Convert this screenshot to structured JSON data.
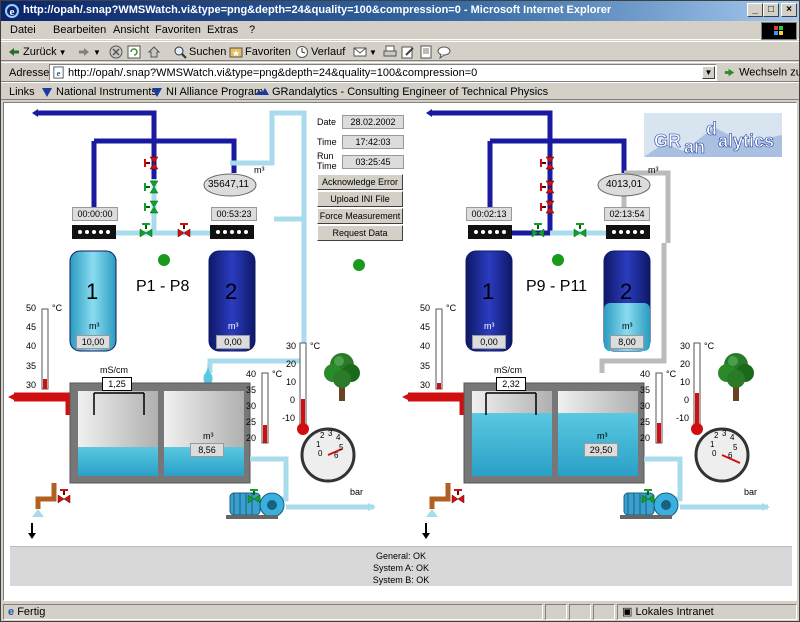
{
  "window": {
    "title": "http://opah/.snap?WMSWatch.vi&type=png&depth=24&quality=100&compression=0 - Microsoft Internet Explorer"
  },
  "menu": [
    "Datei",
    "Bearbeiten",
    "Ansicht",
    "Favoriten",
    "Extras",
    "?"
  ],
  "toolbar": {
    "back": "Zurück",
    "search": "Suchen",
    "favorites": "Favoriten",
    "history": "Verlauf"
  },
  "address": {
    "label": "Adresse",
    "url": "http://opah/.snap?WMSWatch.vi&type=png&depth=24&quality=100&compression=0",
    "go": "Wechseln zu"
  },
  "links": {
    "label": "Links",
    "items": [
      "National Instruments",
      "NI Alliance Program",
      "GRandalytics - Consulting Engineer of Technical Physics"
    ]
  },
  "panel": {
    "date_label": "Date",
    "date": "28.02.2002",
    "time_label": "Time",
    "time": "17:42:03",
    "runtime_label_1": "Run",
    "runtime_label_2": "Time",
    "runtime": "03:25:45",
    "buttons": [
      "Acknowledge Error",
      "Upload INI File",
      "Force Measurement",
      "Request Data"
    ]
  },
  "logo": {
    "part1": "GR",
    "part2": "an",
    "part3": "d",
    "part4": "alytics"
  },
  "systemA": {
    "title": "P1 - P8",
    "meter": "35647,11",
    "timer1": "00:00:00",
    "timer2": "00:53:23",
    "tank1_label": "1",
    "tank1_value": "10,00",
    "tank2_label": "2",
    "tank2_value": "0,00",
    "conductivity": "1,25",
    "volume": "8,56",
    "thermo1_ticks": [
      "50",
      "45",
      "40",
      "35",
      "30"
    ],
    "thermo2_ticks": [
      "40",
      "35",
      "30",
      "25",
      "20"
    ],
    "thermo3_ticks": [
      "30",
      "20",
      "10",
      "0",
      "-10"
    ]
  },
  "systemB": {
    "title": "P9 - P11",
    "meter": "4013,01",
    "timer1": "00:02:13",
    "timer2": "02:13:54",
    "tank1_label": "1",
    "tank1_value": "0,00",
    "tank2_label": "2",
    "tank2_value": "8,00",
    "conductivity": "2,32",
    "volume": "29,50",
    "thermo1_ticks": [
      "50",
      "45",
      "40",
      "35",
      "30"
    ],
    "thermo2_ticks": [
      "40",
      "35",
      "30",
      "25",
      "20"
    ],
    "thermo3_ticks": [
      "30",
      "20",
      "10",
      "0",
      "-10"
    ]
  },
  "units": {
    "volume": "m³",
    "celsius": "°C",
    "conductivity": "mS/cm",
    "pressure": "bar"
  },
  "gauge_ticks": [
    "0",
    "1",
    "2",
    "3",
    "4",
    "5",
    "6"
  ],
  "status": [
    "General: OK",
    "System A: OK",
    "System B: OK"
  ],
  "statusbar": {
    "text": "Fertig",
    "zone": "Lokales Intranet"
  },
  "colors": {
    "pipe_blue": "#1a1aa0",
    "water": "#4db8d8",
    "tank_dark": "#1a2a8c",
    "tank_light": "#4db8d8",
    "pipe_red": "#d01010",
    "pipe_light": "#a8dcec"
  }
}
